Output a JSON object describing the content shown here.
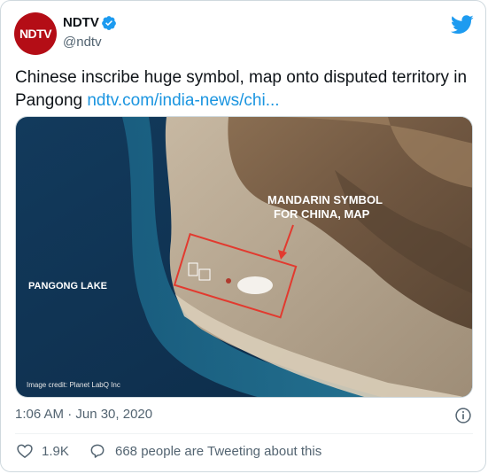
{
  "author": {
    "avatar_text": "NDTV",
    "name": "NDTV",
    "handle": "@ndtv",
    "verified": true
  },
  "tweet": {
    "text": "Chinese inscribe huge symbol, map onto disputed territory in Pangong ",
    "link_text": "ndtv.com/india-news/chi..."
  },
  "media": {
    "label_lake": "PANGONG LAKE",
    "label_symbol_line1": "MANDARIN SYMBOL",
    "label_symbol_line2": "FOR CHINA, MAP",
    "credit": "Image credit: Planet LabQ Inc"
  },
  "meta": {
    "timestamp": "1:06 AM · Jun 30, 2020"
  },
  "actions": {
    "like_count": "1.9K",
    "reply_text": "668 people are Tweeting about this"
  },
  "colors": {
    "brand": "#b40d16",
    "link": "#1b95e0",
    "twitter_blue": "#1d9bf0",
    "muted": "#536471"
  },
  "icons": [
    "ndtv-logo",
    "verified-badge-icon",
    "twitter-bird-icon",
    "info-icon",
    "heart-icon",
    "speech-bubble-icon"
  ]
}
